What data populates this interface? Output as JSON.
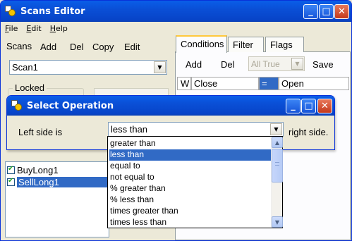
{
  "main_window": {
    "title": "Scans Editor",
    "controls": [
      "_",
      "□",
      "✕"
    ]
  },
  "menu": {
    "file": "File",
    "edit": "Edit",
    "help": "Help"
  },
  "scans_toolbar": {
    "scans": "Scans",
    "add": "Add",
    "del": "Del",
    "copy": "Copy",
    "edit": "Edit"
  },
  "scan_select": {
    "value": "Scan1"
  },
  "locked_label": "Locked",
  "tabs": {
    "conditions": "Conditions",
    "filter": "Filter",
    "flags": "Flags"
  },
  "conditions_toolbar": {
    "add": "Add",
    "del": "Del",
    "mode": "All True",
    "save": "Save"
  },
  "condition_row": {
    "type": "W",
    "left": "Close",
    "op": "=",
    "right": "Open"
  },
  "scan_list": [
    {
      "label": "BuyLong1",
      "checked": true,
      "selected": false
    },
    {
      "label": "SellLong1",
      "checked": true,
      "selected": true
    }
  ],
  "dialog": {
    "title": "Select Operation",
    "left_label": "Left side is",
    "right_label": "right side.",
    "operation_value": "less than"
  },
  "operations": [
    "greater than",
    "less than",
    "equal to",
    "not equal to",
    "% greater than",
    "% less than",
    "times greater than",
    "times less than"
  ],
  "selected_operation": "less than",
  "colors": {
    "titlebar": "#0a4fd6",
    "selection": "#316ac5",
    "close_button": "#c4381b",
    "window_bg": "#ece9d8"
  }
}
